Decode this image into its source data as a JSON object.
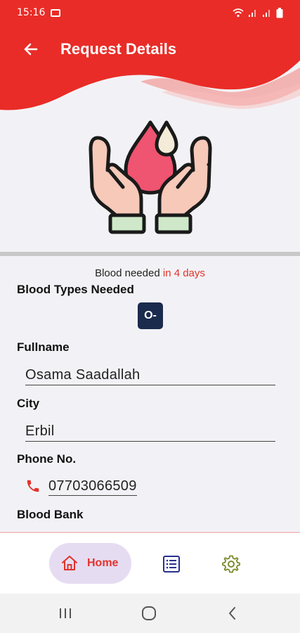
{
  "status_bar": {
    "time": "15:16",
    "icons": [
      "image-icon",
      "wifi-icon",
      "signal-icon",
      "signal-icon",
      "battery-icon"
    ]
  },
  "header": {
    "title": "Request Details",
    "back_icon": "arrow-left-icon",
    "color": "#e92c27"
  },
  "hero": {
    "icon": "hands-holding-blood-drop-icon"
  },
  "request": {
    "needed_prefix": "Blood needed ",
    "needed_when": "in 4 days",
    "blood_types_label": "Blood Types Needed",
    "blood_types": [
      "O-"
    ],
    "fullname_label": "Fullname",
    "fullname": "Osama Saadallah",
    "city_label": "City",
    "city": "Erbil",
    "phone_label": "Phone No.",
    "phone": "07703066509",
    "phone_icon": "phone-icon",
    "blood_bank_label": "Blood Bank"
  },
  "bottom_nav": {
    "items": [
      {
        "label": "Home",
        "icon": "home-icon",
        "active": true
      },
      {
        "label": "",
        "icon": "list-icon",
        "active": false
      },
      {
        "label": "",
        "icon": "gear-icon",
        "active": false
      }
    ]
  },
  "system_nav": {
    "icons": [
      "recents-icon",
      "home-circle-icon",
      "back-chevron-icon"
    ]
  },
  "colors": {
    "accent": "#e92c27",
    "chip": "#1b2b4d",
    "active_pill": "#e6dcf2",
    "list_icon": "#2a2f8f",
    "gear_icon": "#7a8a2a"
  }
}
